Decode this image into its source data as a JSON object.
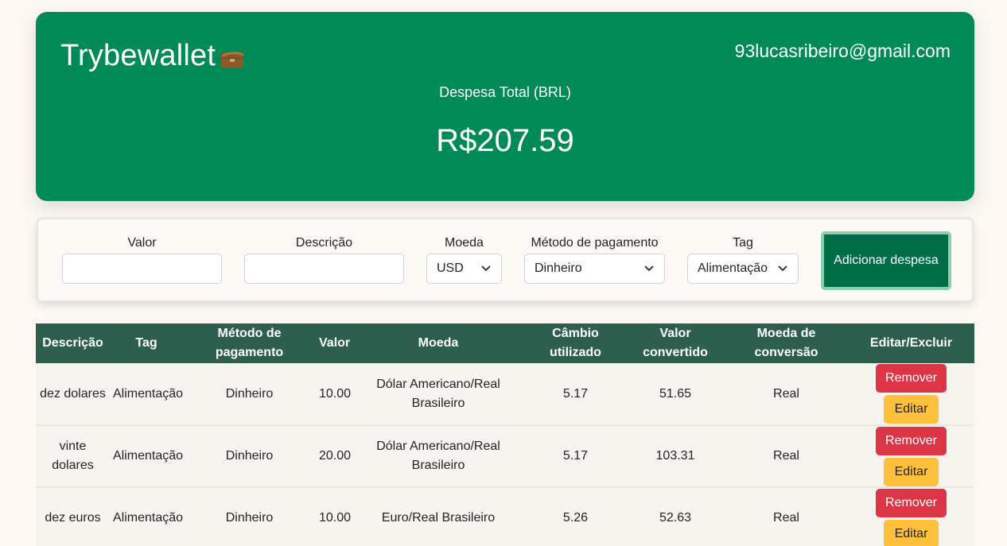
{
  "header": {
    "title": "Trybewallet",
    "wallet_icon": "wallet-icon",
    "email": "93lucasribeiro@gmail.com",
    "total_label": "Despesa Total (BRL)",
    "total_value": "R$207.59"
  },
  "form": {
    "valor_label": "Valor",
    "valor_value": "",
    "descricao_label": "Descrição",
    "descricao_value": "",
    "moeda_label": "Moeda",
    "moeda_selected": "USD",
    "metodo_label": "Método de pagamento",
    "metodo_selected": "Dinheiro",
    "tag_label": "Tag",
    "tag_selected": "Alimentação",
    "add_button": "Adicionar despesa"
  },
  "table": {
    "headers": [
      "Descrição",
      "Tag",
      "Método de pagamento",
      "Valor",
      "Moeda",
      "Câmbio utilizado",
      "Valor convertido",
      "Moeda de conversão",
      "Editar/Excluir"
    ],
    "rows": [
      {
        "descricao": "dez dolares",
        "tag": "Alimentação",
        "metodo": "Dinheiro",
        "valor": "10.00",
        "moeda": "Dólar Americano/Real Brasileiro",
        "cambio": "5.17",
        "convertido": "51.65",
        "conversao": "Real",
        "remove": "Remover",
        "edit": "Editar"
      },
      {
        "descricao": "vinte dolares",
        "tag": "Alimentação",
        "metodo": "Dinheiro",
        "valor": "20.00",
        "moeda": "Dólar Americano/Real Brasileiro",
        "cambio": "5.17",
        "convertido": "103.31",
        "conversao": "Real",
        "remove": "Remover",
        "edit": "Editar"
      },
      {
        "descricao": "dez euros",
        "tag": "Alimentação",
        "metodo": "Dinheiro",
        "valor": "10.00",
        "moeda": "Euro/Real Brasileiro",
        "cambio": "5.26",
        "convertido": "52.63",
        "conversao": "Real",
        "remove": "Remover",
        "edit": "Editar"
      }
    ]
  },
  "colors": {
    "header_bg": "#008a58",
    "table_header_bg": "#2e5e4e",
    "add_button_bg": "#006d46",
    "remove_bg": "#dc3545",
    "edit_bg": "#ffc13b"
  }
}
